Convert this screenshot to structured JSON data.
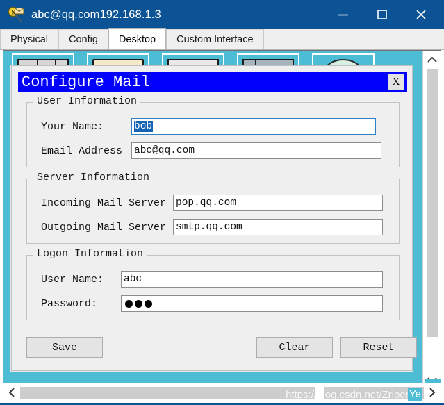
{
  "window": {
    "title": "abc@qq.com192.168.1.3",
    "icon": "mail-magnifier-icon",
    "controls": {
      "minimize": "minimize-icon",
      "maximize": "maximize-icon",
      "close": "close-icon"
    },
    "titlebar_color": "#0b5394"
  },
  "tabs": [
    {
      "label": "Physical",
      "active": false
    },
    {
      "label": "Config",
      "active": false
    },
    {
      "label": "Desktop",
      "active": true
    },
    {
      "label": "Custom Interface",
      "active": false
    }
  ],
  "desktop": {
    "background_color": "#4cbdd4",
    "tiles": [
      "desktop-tile-1",
      "desktop-tile-2",
      "desktop-tile-3",
      "desktop-tile-4",
      "desktop-tile-5"
    ]
  },
  "dialog": {
    "title": "Configure Mail",
    "title_bg": "#0000fc",
    "close_label": "X",
    "groups": {
      "user": {
        "legend": "User Information",
        "fields": [
          {
            "label": "Your Name:",
            "value": "bob",
            "focused": true,
            "selected": true
          },
          {
            "label": "Email Address",
            "value": "abc@qq.com",
            "focused": false,
            "selected": false
          }
        ]
      },
      "server": {
        "legend": "Server Information",
        "fields": [
          {
            "label": "Incoming Mail Server",
            "value": "pop.qq.com",
            "focused": false,
            "selected": false
          },
          {
            "label": "Outgoing Mail Server",
            "value": "smtp.qq.com",
            "focused": false,
            "selected": false
          }
        ]
      },
      "logon": {
        "legend": "Logon Information",
        "fields": [
          {
            "label": "User Name:",
            "value": "abc",
            "focused": false,
            "selected": false
          },
          {
            "label": "Password:",
            "value": "",
            "masked": true,
            "mask_count": 3,
            "focused": false,
            "selected": false
          }
        ]
      }
    },
    "buttons": {
      "save": "Save",
      "clear": "Clear",
      "reset": "Reset"
    }
  },
  "scrollbars": {
    "vertical": {
      "up": "chevron-up-icon",
      "down": "chevron-down-icon"
    },
    "horizontal": {
      "left": "chevron-left-icon",
      "right": "chevron-right-icon"
    }
  },
  "watermark": {
    "text": "https://blog.csdn.net/Zripen",
    "badge": "Ye"
  }
}
